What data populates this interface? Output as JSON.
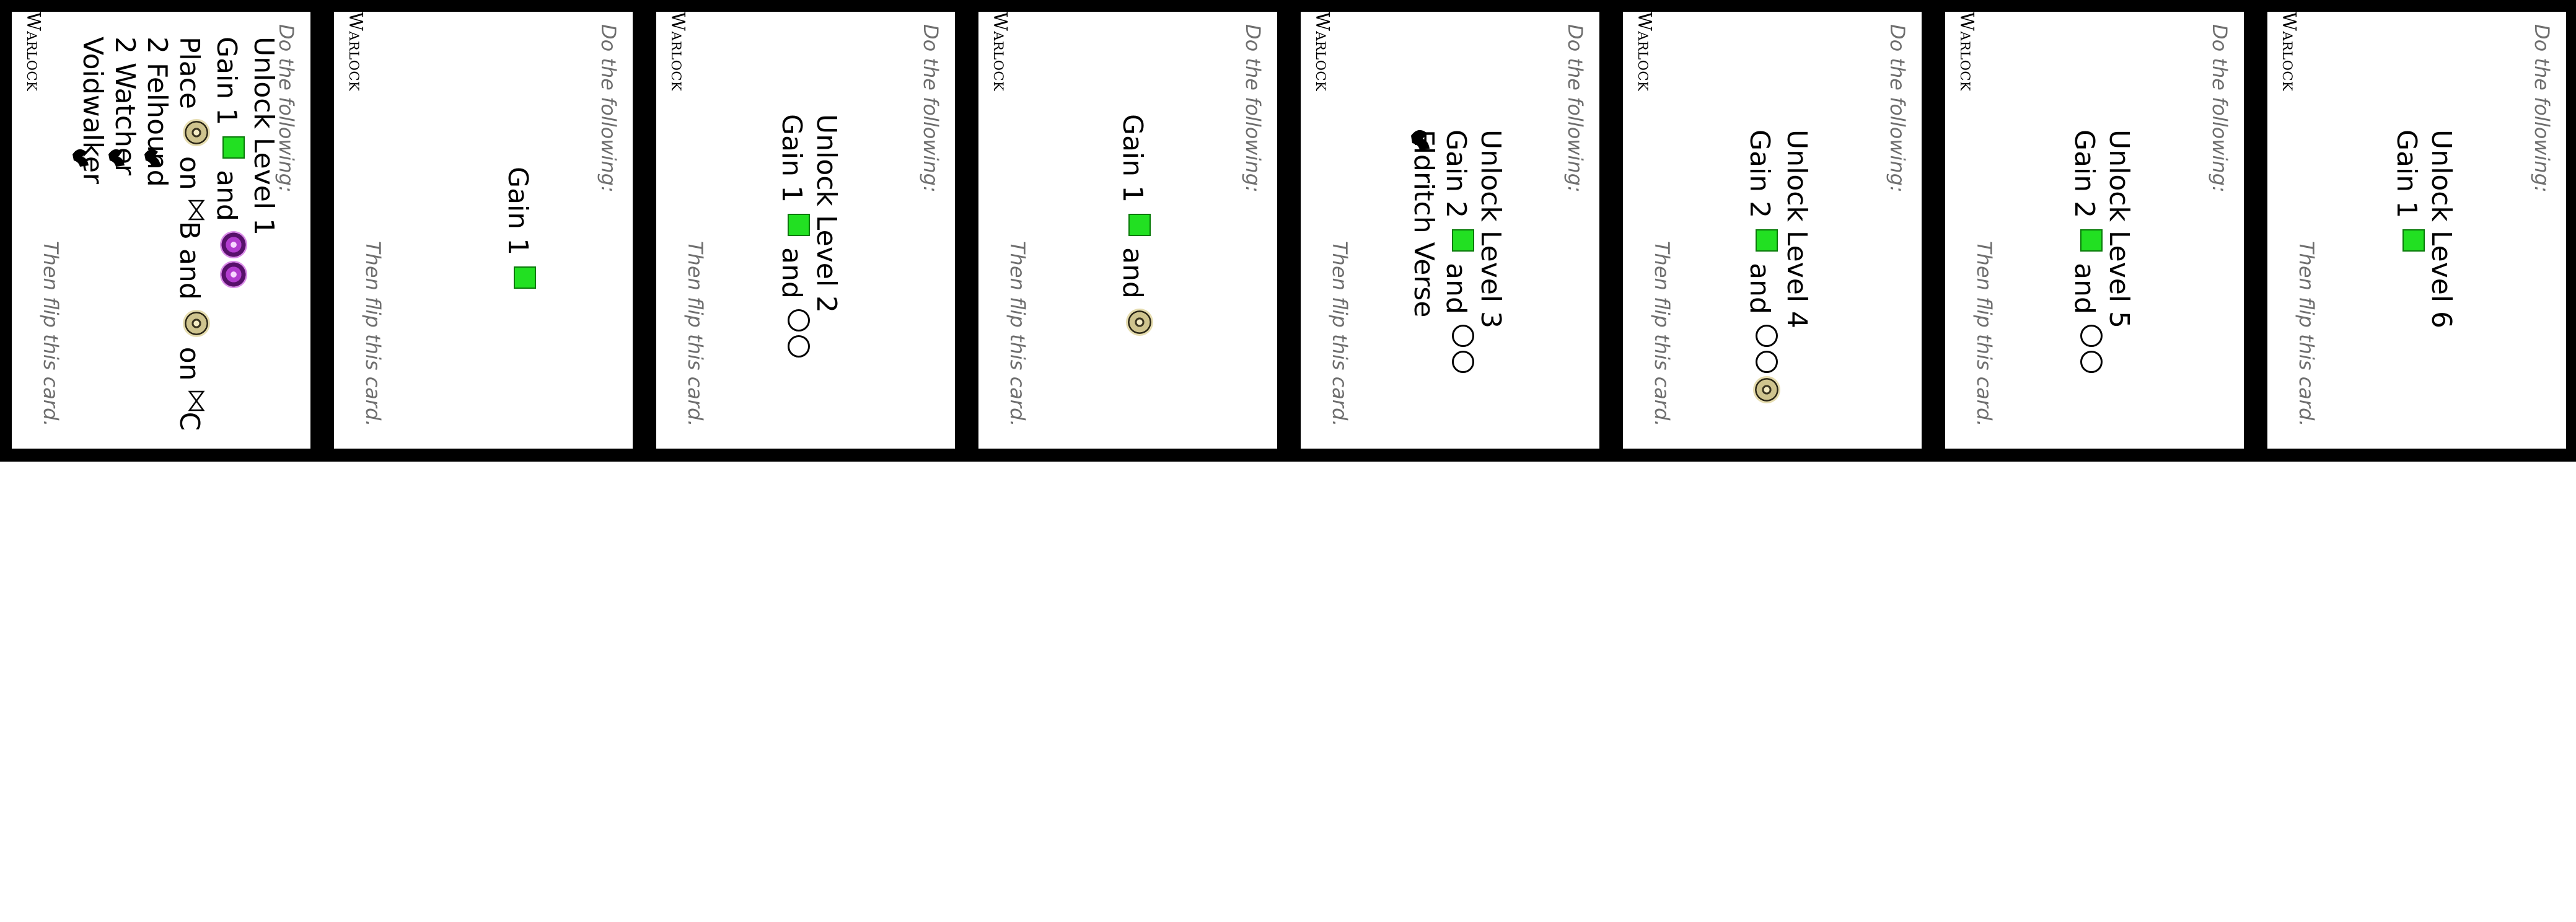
{
  "cards": [
    {
      "corner": "Warlock",
      "header": "Do the following:",
      "footer": "Then flip this card.",
      "lines": [
        {
          "a": "Unlock Level 1"
        },
        {
          "a": "Gain 1",
          "b": "and"
        },
        {
          "a": "Place",
          "b": "on",
          "c": "B and",
          "d": "on",
          "e": "C"
        },
        {
          "a": "2 Felhound"
        },
        {
          "a": "2 Watcher"
        },
        {
          "a": "Voidwalker"
        }
      ]
    },
    {
      "corner": "Warlock",
      "header": "Do the following:",
      "footer": "Then flip this card.",
      "lines": [
        {
          "a": "Gain 1"
        }
      ]
    },
    {
      "corner": "Warlock",
      "header": "Do the following:",
      "footer": "Then flip this card.",
      "lines": [
        {
          "a": "Unlock Level 2"
        },
        {
          "a": "Gain 1",
          "b": "and"
        }
      ]
    },
    {
      "corner": "Warlock",
      "header": "Do the following:",
      "footer": "Then flip this card.",
      "lines": [
        {
          "a": "Gain 1",
          "b": "and"
        }
      ]
    },
    {
      "corner": "Warlock",
      "header": "Do the following:",
      "footer": "Then flip this card.",
      "lines": [
        {
          "a": "Unlock Level 3"
        },
        {
          "a": "Gain 2",
          "b": "and"
        },
        {
          "a": "Eldritch Verse"
        }
      ]
    },
    {
      "corner": "Warlock",
      "header": "Do the following:",
      "footer": "Then flip this card.",
      "lines": [
        {
          "a": "Unlock Level 4"
        },
        {
          "a": "Gain 2",
          "b": "and"
        }
      ]
    },
    {
      "corner": "Warlock",
      "header": "Do the following:",
      "footer": "Then flip this card.",
      "lines": [
        {
          "a": "Unlock Level 5"
        },
        {
          "a": "Gain 2",
          "b": "and"
        }
      ]
    },
    {
      "corner": "Warlock",
      "header": "Do the following:",
      "footer": "Then flip this card.",
      "lines": [
        {
          "a": "Unlock Level 6"
        },
        {
          "a": "Gain 1"
        }
      ]
    }
  ],
  "icons": {
    "green_square": "experience-cube-icon",
    "empty_circle": "empty-slot-icon",
    "felhound_token": "felhound-token-icon",
    "shadow_token": "shadow-orb-icon",
    "hourglass": "hourglass-icon",
    "minion": "summon-minion-icon"
  },
  "colors": {
    "card_bg": "#ffffff",
    "border": "#000000",
    "green": "#22e022",
    "note_text": "#6e6e6e"
  }
}
